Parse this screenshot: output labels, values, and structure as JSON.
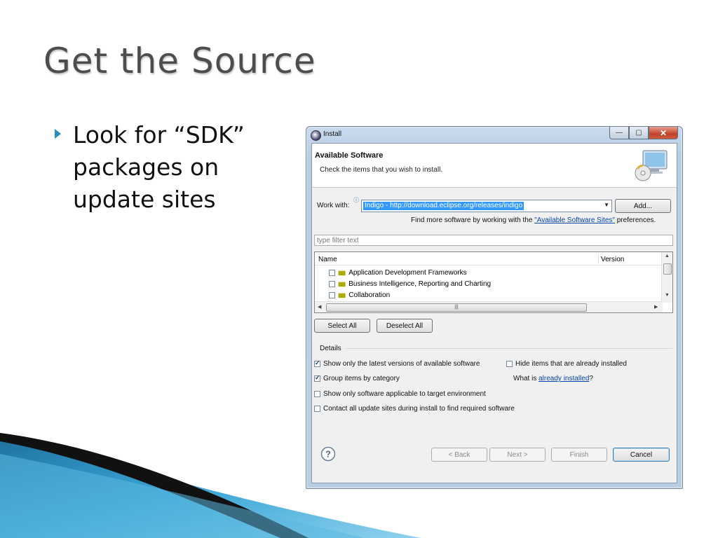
{
  "slide": {
    "title": "Get the Source",
    "bullet": "Look for “SDK” packages on update sites"
  },
  "window": {
    "title": "Install",
    "banner": {
      "title": "Available Software",
      "description": "Check the items that you wish to install."
    },
    "work_with": {
      "label": "Work with:",
      "value": "Indigo - http://download.eclipse.org/releases/indigo",
      "add_button": "Add..."
    },
    "more_software": {
      "prefix": "Find more software by working with the",
      "link": "\"Available Software Sites\"",
      "suffix": "preferences."
    },
    "filter_placeholder": "type filter text",
    "table": {
      "columns": [
        "Name",
        "Version"
      ],
      "rows": [
        {
          "name": "Application Development Frameworks",
          "checked": false
        },
        {
          "name": "Business Intelligence, Reporting and Charting",
          "checked": false
        },
        {
          "name": "Collaboration",
          "checked": false
        }
      ]
    },
    "select_all": "Select All",
    "deselect_all": "Deselect All",
    "details_label": "Details",
    "options": {
      "latest_versions": {
        "label": "Show only the latest versions of available software",
        "checked": true
      },
      "hide_installed": {
        "label": "Hide items that are already installed",
        "checked": false
      },
      "group_by_category": {
        "label": "Group items by category",
        "checked": true
      },
      "what_is_prefix": "What is",
      "what_is_link": "already installed",
      "what_is_suffix": "?",
      "target_env": {
        "label": "Show only software applicable to target environment",
        "checked": false
      },
      "contact_sites": {
        "label": "Contact all update sites during install to find required software",
        "checked": false
      }
    },
    "footer": {
      "back": "< Back",
      "next": "Next >",
      "finish": "Finish",
      "cancel": "Cancel"
    }
  },
  "colors": {
    "title_gray": "#4d4d4d",
    "bullet_blue": "#2a8fbf",
    "selection_blue": "#3399ff"
  }
}
